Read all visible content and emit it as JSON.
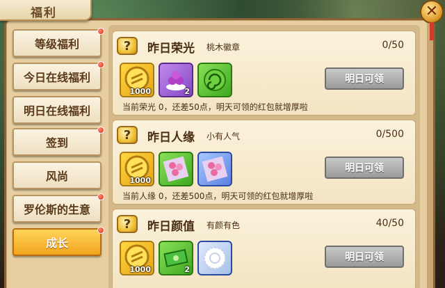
{
  "title": "福利",
  "sidebar": {
    "items": [
      {
        "label": "等级福利",
        "dot": true,
        "active": false
      },
      {
        "label": "今日在线福利",
        "dot": true,
        "active": false
      },
      {
        "label": "明日在线福利",
        "dot": false,
        "active": false
      },
      {
        "label": "签到",
        "dot": true,
        "active": false
      },
      {
        "label": "风尚",
        "dot": false,
        "active": false
      },
      {
        "label": "罗伦斯的生意",
        "dot": true,
        "active": false
      },
      {
        "label": "成长",
        "dot": true,
        "active": true
      }
    ]
  },
  "cards": [
    {
      "title": "昨日荣光",
      "subtitle": "桃木徽章",
      "count": "0/50",
      "items": [
        {
          "icon": "gold-coin-icon",
          "qty": "1000"
        },
        {
          "icon": "purple-grapes-icon",
          "qty": "2"
        },
        {
          "icon": "green-swirl-icon",
          "qty": ""
        }
      ],
      "button": "明日可领",
      "desc": "当前荣光 0，还差50点，明天可领的红包就增厚啦"
    },
    {
      "title": "昨日人缘",
      "subtitle": "小有人气",
      "count": "0/500",
      "items": [
        {
          "icon": "gold-coin-icon",
          "qty": "1000"
        },
        {
          "icon": "flower-bouquet-icon",
          "qty": ""
        },
        {
          "icon": "flower-bouquet-icon",
          "qty": ""
        }
      ],
      "button": "明日可领",
      "desc": "当前人缘 0，还差500点，明天可领的红包就增厚啦"
    },
    {
      "title": "昨日颜值",
      "subtitle": "有颜有色",
      "count": "40/50",
      "items": [
        {
          "icon": "gold-coin-icon",
          "qty": "1000"
        },
        {
          "icon": "green-cash-icon",
          "qty": "2"
        },
        {
          "icon": "lace-doily-icon",
          "qty": ""
        }
      ],
      "button": "明日可领",
      "desc": ""
    }
  ]
}
